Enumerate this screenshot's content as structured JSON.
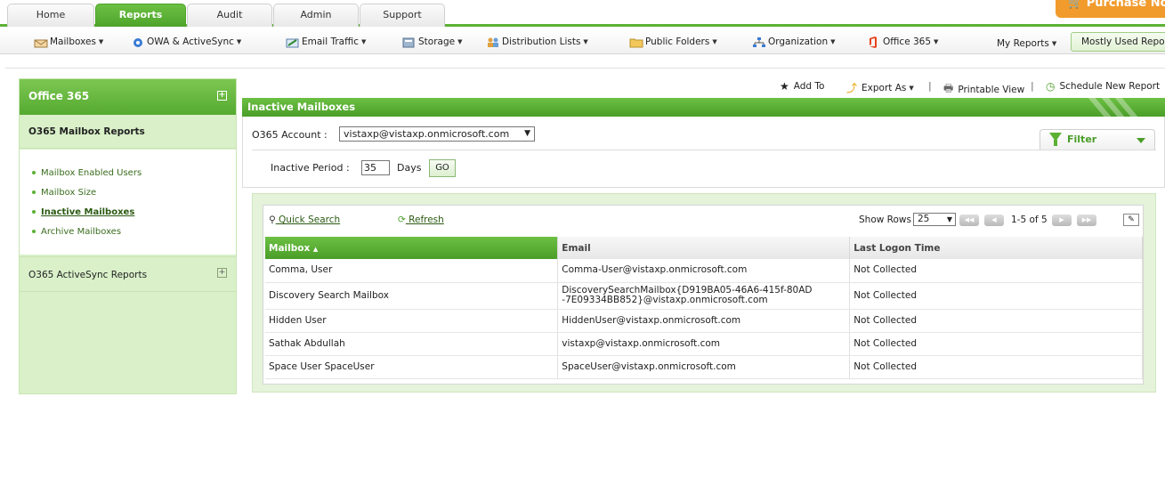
{
  "top_tabs": [
    "Home",
    "Reports",
    "Audit",
    "Admin",
    "Support"
  ],
  "active_tab": "Reports",
  "purchase_label": "Purchase No",
  "nav2": {
    "mailboxes": "Mailboxes",
    "owa": "OWA & ActiveSync",
    "email_traffic": "Email Traffic",
    "storage": "Storage",
    "distribution_lists": "Distribution Lists",
    "public_folders": "Public Folders",
    "organization": "Organization",
    "office365": "Office 365",
    "my_reports": "My Reports",
    "mostly_used": "Mostly Used Repo"
  },
  "sidebar": {
    "title": "Office 365",
    "section1": "O365 Mailbox Reports",
    "links": [
      "Mailbox Enabled Users",
      "Mailbox Size",
      "Inactive Mailboxes",
      "Archive Mailboxes"
    ],
    "active_link": "Inactive Mailboxes",
    "section2": "O365 ActiveSync Reports"
  },
  "actions": {
    "add_to": "Add To",
    "export_as": "Export As",
    "printable_view": "Printable View",
    "schedule": "Schedule New Report"
  },
  "content": {
    "title": "Inactive Mailboxes",
    "account_label": "O365 Account :",
    "account_value": "vistaxp@vistaxp.onmicrosoft.com",
    "filter_label": "Filter",
    "period_label": "Inactive Period :",
    "period_value": "35",
    "days_label": "Days",
    "go_label": "GO"
  },
  "grid": {
    "quick_search": "Quick Search",
    "refresh": "Refresh",
    "show_rows_label": "Show Rows",
    "rows_value": "25",
    "page_info": "1-5 of 5",
    "columns": [
      "Mailbox",
      "Email",
      "Last Logon Time"
    ],
    "sorted_column_suffix": "▲",
    "rows": [
      {
        "mailbox": "Comma, User",
        "email": "Comma-User@vistaxp.onmicrosoft.com",
        "last_logon": "Not Collected"
      },
      {
        "mailbox": "Discovery Search Mailbox",
        "email": "DiscoverySearchMailbox{D919BA05-46A6-415f-80AD-7E09334BB852}@vistaxp.onmicrosoft.com",
        "last_logon": "Not Collected"
      },
      {
        "mailbox": "Hidden User",
        "email": "HiddenUser@vistaxp.onmicrosoft.com",
        "last_logon": "Not Collected"
      },
      {
        "mailbox": "Sathak Abdullah",
        "email": "vistaxp@vistaxp.onmicrosoft.com",
        "last_logon": "Not Collected"
      },
      {
        "mailbox": "Space User SpaceUser",
        "email": "SpaceUser@vistaxp.onmicrosoft.com",
        "last_logon": "Not Collected"
      }
    ]
  },
  "colors": {
    "brand_green": "#5cb135",
    "purchase_orange": "#f19b2c",
    "sidebar_bg": "#d9f0c9"
  },
  "icons": [
    "mailbox-icon",
    "owa-icon",
    "email-traffic-icon",
    "storage-icon",
    "distribution-list-icon",
    "folder-icon",
    "organization-icon",
    "office365-icon",
    "star-icon",
    "export-icon",
    "printer-icon",
    "schedule-icon",
    "filter-icon",
    "search-icon",
    "refresh-icon",
    "cart-icon"
  ]
}
